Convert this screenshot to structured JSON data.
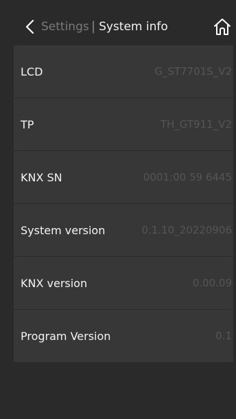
{
  "header": {
    "back_label": "Settings",
    "separator": "|",
    "title": "System info",
    "back_icon": "chevron-left-icon",
    "home_icon": "home-icon"
  },
  "info": {
    "rows": [
      {
        "label": "LCD",
        "value": "G_ST7701S_V2"
      },
      {
        "label": "TP",
        "value": "TH_GT911_V2"
      },
      {
        "label": "KNX SN",
        "value": "0001:00 59 6445"
      },
      {
        "label": "System version",
        "value": "0.1.10_20220906"
      },
      {
        "label": "KNX version",
        "value": "0.00.09"
      },
      {
        "label": "Program Version",
        "value": "0.1"
      }
    ]
  },
  "colors": {
    "background": "#2a2a2a",
    "row_background": "#373737",
    "label_text": "#f4f4f4",
    "value_text": "#555555",
    "back_text": "#7a7a7a"
  }
}
